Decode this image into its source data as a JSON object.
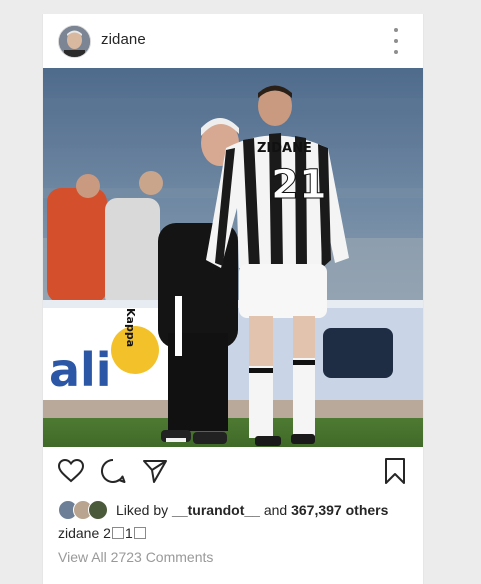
{
  "post": {
    "username": "zidane",
    "more_icon": "more-vertical-icon"
  },
  "photo": {
    "jersey_name": "ZIDANE",
    "jersey_number": "21",
    "jacket_brand": "Kappa",
    "alt_subject": "coach talking to player number 21"
  },
  "actions": {
    "icons": [
      "heart-icon",
      "comment-icon",
      "share-icon",
      "bookmark-icon"
    ]
  },
  "likes": {
    "prefix": "Liked by ",
    "user": "__turandot__",
    "middle": " and ",
    "count": "367,397 others"
  },
  "caption": {
    "username": "zidane",
    "text_a": " 2",
    "text_b": "1"
  },
  "comments": {
    "label": "View All 2723 Comments"
  },
  "colors": {
    "text": "#262626",
    "muted": "#999999",
    "background": "#ececec"
  }
}
